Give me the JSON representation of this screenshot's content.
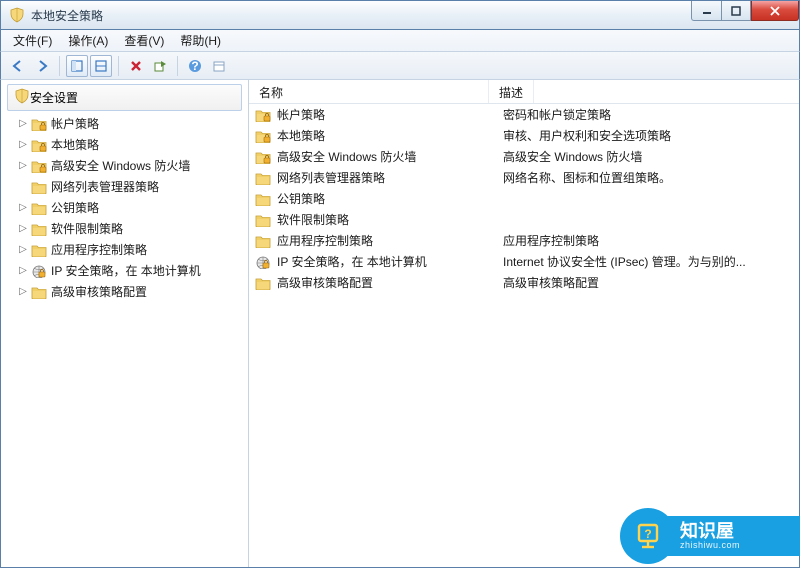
{
  "window": {
    "title": "本地安全策略",
    "controls": {
      "min": "minimize",
      "max": "maximize",
      "close": "close"
    }
  },
  "menu": {
    "file": "文件(F)",
    "action": "操作(A)",
    "view": "查看(V)",
    "help": "帮助(H)"
  },
  "toolbar_icons": {
    "back": "back",
    "forward": "forward",
    "up": "up",
    "show_tree": "show-tree",
    "delete": "delete",
    "export": "export",
    "help": "help",
    "props": "properties"
  },
  "tree": {
    "root": "安全设置",
    "items": [
      {
        "label": "帐户策略",
        "expandable": true,
        "icon": "folder-lock"
      },
      {
        "label": "本地策略",
        "expandable": true,
        "icon": "folder-lock"
      },
      {
        "label": "高级安全 Windows 防火墙",
        "expandable": true,
        "icon": "folder-lock"
      },
      {
        "label": "网络列表管理器策略",
        "expandable": false,
        "icon": "folder"
      },
      {
        "label": "公钥策略",
        "expandable": true,
        "icon": "folder"
      },
      {
        "label": "软件限制策略",
        "expandable": true,
        "icon": "folder"
      },
      {
        "label": "应用程序控制策略",
        "expandable": true,
        "icon": "folder"
      },
      {
        "label": "IP 安全策略，在 本地计算机",
        "expandable": true,
        "icon": "ipsec"
      },
      {
        "label": "高级审核策略配置",
        "expandable": true,
        "icon": "folder"
      }
    ]
  },
  "list": {
    "columns": {
      "name": "名称",
      "desc": "描述"
    },
    "rows": [
      {
        "name": "帐户策略",
        "desc": "密码和帐户锁定策略",
        "icon": "folder-lock"
      },
      {
        "name": "本地策略",
        "desc": "审核、用户权利和安全选项策略",
        "icon": "folder-lock"
      },
      {
        "name": "高级安全 Windows 防火墙",
        "desc": "高级安全 Windows 防火墙",
        "icon": "folder-lock"
      },
      {
        "name": "网络列表管理器策略",
        "desc": "网络名称、图标和位置组策略。",
        "icon": "folder"
      },
      {
        "name": "公钥策略",
        "desc": "",
        "icon": "folder"
      },
      {
        "name": "软件限制策略",
        "desc": "",
        "icon": "folder"
      },
      {
        "name": "应用程序控制策略",
        "desc": "应用程序控制策略",
        "icon": "folder"
      },
      {
        "name": "IP 安全策略，在 本地计算机",
        "desc": "Internet 协议安全性 (IPsec) 管理。为与别的...",
        "icon": "ipsec"
      },
      {
        "name": "高级审核策略配置",
        "desc": "高级审核策略配置",
        "icon": "folder"
      }
    ]
  },
  "watermark": {
    "title": "知识屋",
    "url": "zhishiwu.com"
  }
}
